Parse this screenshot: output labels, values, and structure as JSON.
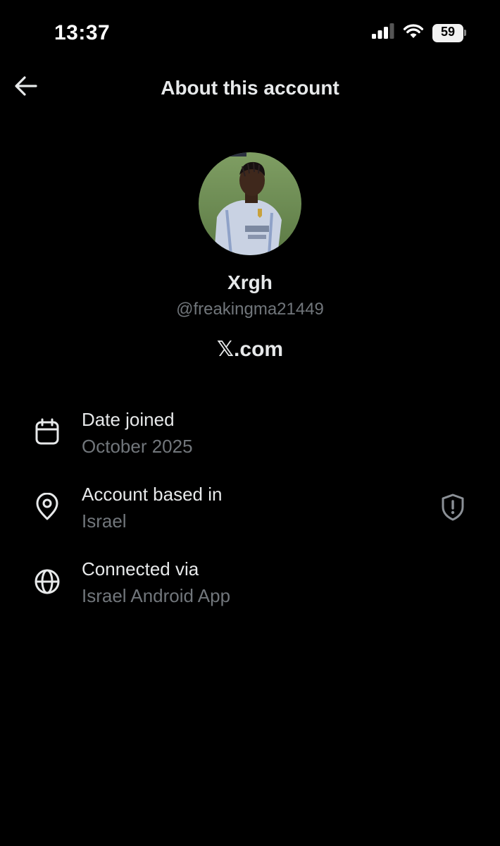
{
  "status_bar": {
    "time": "13:37",
    "battery_level": "59",
    "signal_icon": "cellular-signal-icon",
    "wifi_icon": "wifi-icon"
  },
  "header": {
    "title": "About this account",
    "back_icon": "back-arrow-icon"
  },
  "profile": {
    "display_name": "Xrgh",
    "handle": "@freakingma21449",
    "site": "𝕏.com",
    "avatar": "avatar-photo-football-player"
  },
  "info": [
    {
      "icon": "calendar-icon",
      "title": "Date joined",
      "value": "October 2025"
    },
    {
      "icon": "location-pin-icon",
      "title": "Account based in",
      "value": "Israel",
      "action_icon": "shield-alert-icon"
    },
    {
      "icon": "globe-icon",
      "title": "Connected via",
      "value": "Israel Android App"
    }
  ],
  "colors": {
    "background": "#000000",
    "primary_text": "#e7e9ea",
    "secondary_text": "#71767b"
  }
}
